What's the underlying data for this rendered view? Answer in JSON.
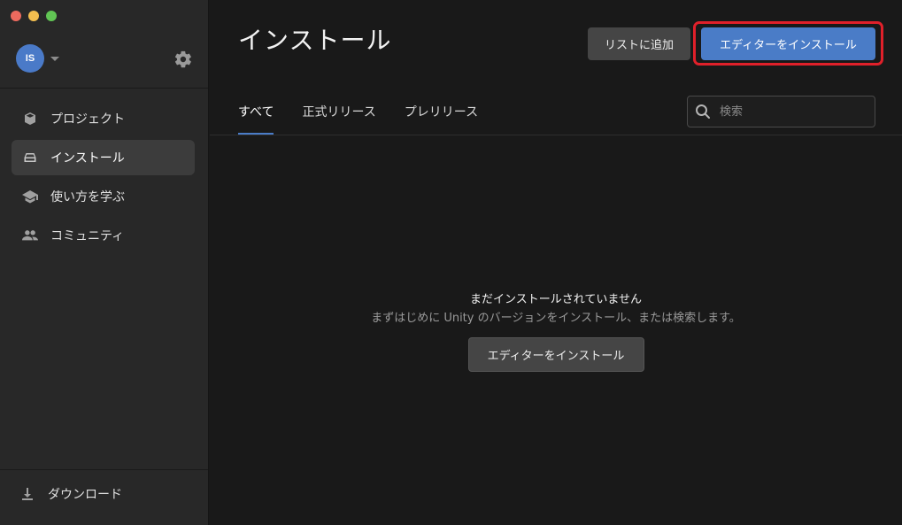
{
  "window": {
    "traffic_lights": [
      "close",
      "minimize",
      "maximize"
    ]
  },
  "sidebar": {
    "account": {
      "initials": "IS",
      "icon": "chevron-down-icon"
    },
    "settings_icon": "gear-icon",
    "items": [
      {
        "label": "プロジェクト",
        "icon": "cube-icon",
        "active": false
      },
      {
        "label": "インストール",
        "icon": "drive-icon",
        "active": true
      },
      {
        "label": "使い方を学ぶ",
        "icon": "graduation-cap-icon",
        "active": false
      },
      {
        "label": "コミュニティ",
        "icon": "people-icon",
        "active": false
      }
    ],
    "downloads": {
      "label": "ダウンロード",
      "icon": "download-icon"
    }
  },
  "main": {
    "title": "インストール",
    "buttons": {
      "add_to_list": "リストに追加",
      "install_editor": "エディターをインストール"
    },
    "tabs": [
      {
        "label": "すべて",
        "active": true
      },
      {
        "label": "正式リリース",
        "active": false
      },
      {
        "label": "プレリリース",
        "active": false
      }
    ],
    "search": {
      "placeholder": "検索",
      "value": ""
    },
    "empty_state": {
      "title": "まだインストールされていません",
      "subtitle": "まずはじめに Unity のバージョンをインストール、または検索します。",
      "button": "エディターをインストール"
    }
  },
  "colors": {
    "accent": "#4a7cc7",
    "highlight": "#e0202a",
    "avatar": "#4a7ac8"
  }
}
